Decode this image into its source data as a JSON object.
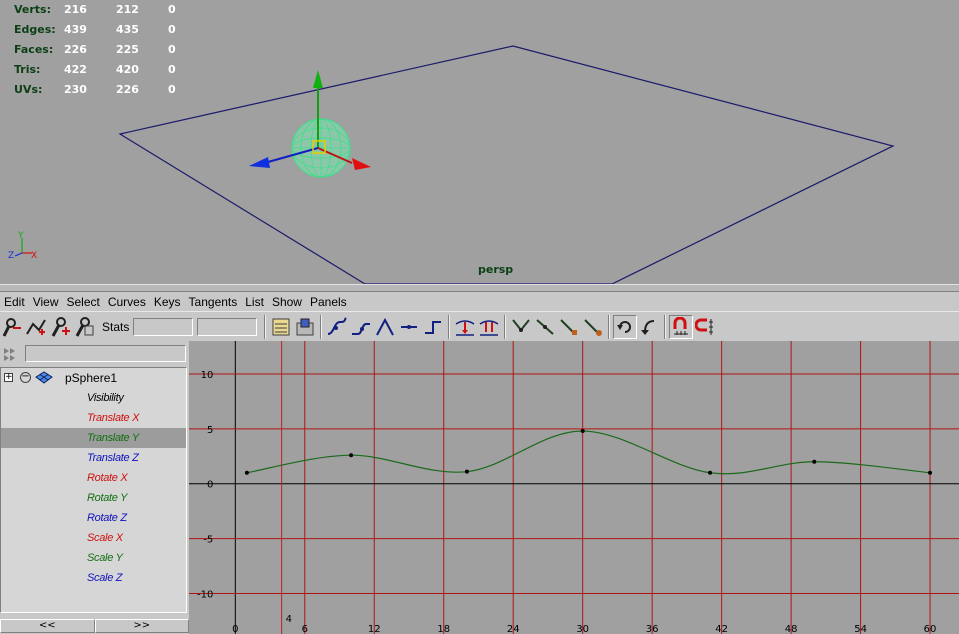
{
  "viewport": {
    "camera_label": "persp",
    "hud": [
      {
        "label": "Verts:",
        "values": [
          "216",
          "212",
          "0"
        ]
      },
      {
        "label": "Edges:",
        "values": [
          "439",
          "435",
          "0"
        ]
      },
      {
        "label": "Faces:",
        "values": [
          "226",
          "225",
          "0"
        ]
      },
      {
        "label": "Tris:",
        "values": [
          "422",
          "420",
          "0"
        ]
      },
      {
        "label": "UVs:",
        "values": [
          "230",
          "226",
          "0"
        ]
      }
    ],
    "axis_indicator": {
      "y": "Y",
      "z": "Z",
      "x": "X"
    }
  },
  "menubar": [
    "Edit",
    "View",
    "Select",
    "Curves",
    "Keys",
    "Tangents",
    "List",
    "Show",
    "Panels"
  ],
  "toolbar": {
    "stats_label": "Stats",
    "icons": [
      "move-nearest-picked-key-icon",
      "insert-keys-icon",
      "add-keys-icon",
      "lattice-deform-keys-icon",
      "frame-all-icon",
      "frame-playback-range-icon",
      "spline-tangent-icon",
      "clamped-tangent-icon",
      "linear-tangent-icon",
      "flat-tangent-icon",
      "step-tangent-icon",
      "plateau-tangent-icon",
      "buffer-curve-icon",
      "break-tangents-icon",
      "unify-tangents-icon",
      "free-tangent-weight-icon",
      "lock-tangent-weight-icon",
      "cycle-icon",
      "undo-icon",
      "time-snap-icon",
      "value-snap-icon"
    ]
  },
  "outliner": {
    "object": "pSphere1",
    "attributes": [
      {
        "label": "Visibility",
        "color": "#000000"
      },
      {
        "label": "Translate X",
        "color": "#d01010"
      },
      {
        "label": "Translate Y",
        "color": "#107010",
        "selected": true
      },
      {
        "label": "Translate Z",
        "color": "#1010c0"
      },
      {
        "label": "Rotate X",
        "color": "#d01010"
      },
      {
        "label": "Rotate Y",
        "color": "#107010"
      },
      {
        "label": "Rotate Z",
        "color": "#1010c0"
      },
      {
        "label": "Scale X",
        "color": "#d01010"
      },
      {
        "label": "Scale Y",
        "color": "#107010"
      },
      {
        "label": "Scale Z",
        "color": "#1010c0"
      }
    ],
    "scroll_left": "<<",
    "scroll_right": ">>"
  },
  "chart_data": {
    "type": "line",
    "x_ticks": [
      0,
      6,
      12,
      18,
      24,
      30,
      36,
      42,
      48,
      54,
      60
    ],
    "y_ticks": [
      10,
      5,
      0,
      -5,
      -10
    ],
    "xlim": [
      -4,
      62.5
    ],
    "ylim": [
      -12.5,
      13
    ],
    "current_time": 4,
    "series": [
      {
        "color": "#1a6a1a",
        "keys": [
          [
            1,
            1
          ],
          [
            10,
            2.6
          ],
          [
            20,
            1.1
          ],
          [
            30,
            4.8
          ],
          [
            41,
            1.0
          ],
          [
            50,
            2.0
          ],
          [
            60,
            1.0
          ]
        ]
      }
    ]
  }
}
